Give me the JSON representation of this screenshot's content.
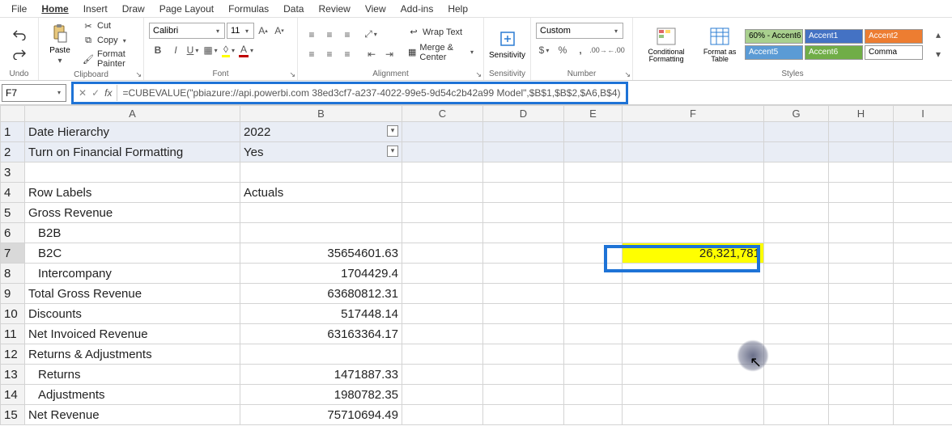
{
  "menu": [
    "File",
    "Home",
    "Insert",
    "Draw",
    "Page Layout",
    "Formulas",
    "Data",
    "Review",
    "View",
    "Add-ins",
    "Help"
  ],
  "menu_active": "Home",
  "ribbon": {
    "undo": {
      "label": "Undo"
    },
    "clipboard": {
      "label": "Clipboard",
      "paste": "Paste",
      "cut": "Cut",
      "copy": "Copy",
      "format_painter": "Format Painter"
    },
    "font": {
      "label": "Font",
      "name": "Calibri",
      "size": "11",
      "bold": "B",
      "italic": "I",
      "underline": "U"
    },
    "alignment": {
      "label": "Alignment",
      "wrap": "Wrap Text",
      "merge": "Merge & Center"
    },
    "sensitivity": {
      "label": "Sensitivity",
      "btn": "Sensitivity"
    },
    "number": {
      "label": "Number",
      "format": "Custom"
    },
    "styles": {
      "label": "Styles",
      "cond": "Conditional Formatting",
      "table": "Format as Table",
      "cells": [
        {
          "name": "60% - Accent6",
          "bg": "#a9d08e",
          "fg": "#000"
        },
        {
          "name": "Accent1",
          "bg": "#4472c4",
          "fg": "#fff"
        },
        {
          "name": "Accent2",
          "bg": "#ed7d31",
          "fg": "#fff"
        },
        {
          "name": "Accent5",
          "bg": "#5b9bd5",
          "fg": "#fff"
        },
        {
          "name": "Accent6",
          "bg": "#70ad47",
          "fg": "#fff"
        },
        {
          "name": "Comma",
          "bg": "#fff",
          "fg": "#000"
        }
      ]
    }
  },
  "name_box": "F7",
  "formula": "=CUBEVALUE(\"pbiazure://api.powerbi.com 38ed3cf7-a237-4022-99e5-9d54c2b42a99 Model\",$B$1,$B$2,$A6,B$4)",
  "columns": [
    "A",
    "B",
    "C",
    "D",
    "E",
    "F",
    "G",
    "H",
    "I"
  ],
  "rows": [
    {
      "n": 1,
      "A": "Date Hierarchy",
      "B": "2022",
      "filter": true
    },
    {
      "n": 2,
      "A": "Turn on Financial Formatting",
      "B": "Yes",
      "filter": true
    },
    {
      "n": 3
    },
    {
      "n": 4,
      "A": "Row Labels",
      "B": "Actuals"
    },
    {
      "n": 5,
      "A": "Gross Revenue"
    },
    {
      "n": 6,
      "A": "B2B",
      "indent": 1
    },
    {
      "n": 7,
      "A": "B2C",
      "B": "35654601.63",
      "indent": 1,
      "F": "26,321,781"
    },
    {
      "n": 8,
      "A": "Intercompany",
      "B": "1704429.4",
      "indent": 1
    },
    {
      "n": 9,
      "A": "Total Gross Revenue",
      "B": "63680812.31"
    },
    {
      "n": 10,
      "A": "Discounts",
      "B": "517448.14"
    },
    {
      "n": 11,
      "A": "Net Invoiced Revenue",
      "B": "63163364.17"
    },
    {
      "n": 12,
      "A": "Returns & Adjustments"
    },
    {
      "n": 13,
      "A": "Returns",
      "B": "1471887.33",
      "indent": 1
    },
    {
      "n": 14,
      "A": "Adjustments",
      "B": "1980782.35",
      "indent": 1
    },
    {
      "n": 15,
      "A": "Net Revenue",
      "B": "75710694.49"
    }
  ],
  "selected_cell": "F7"
}
